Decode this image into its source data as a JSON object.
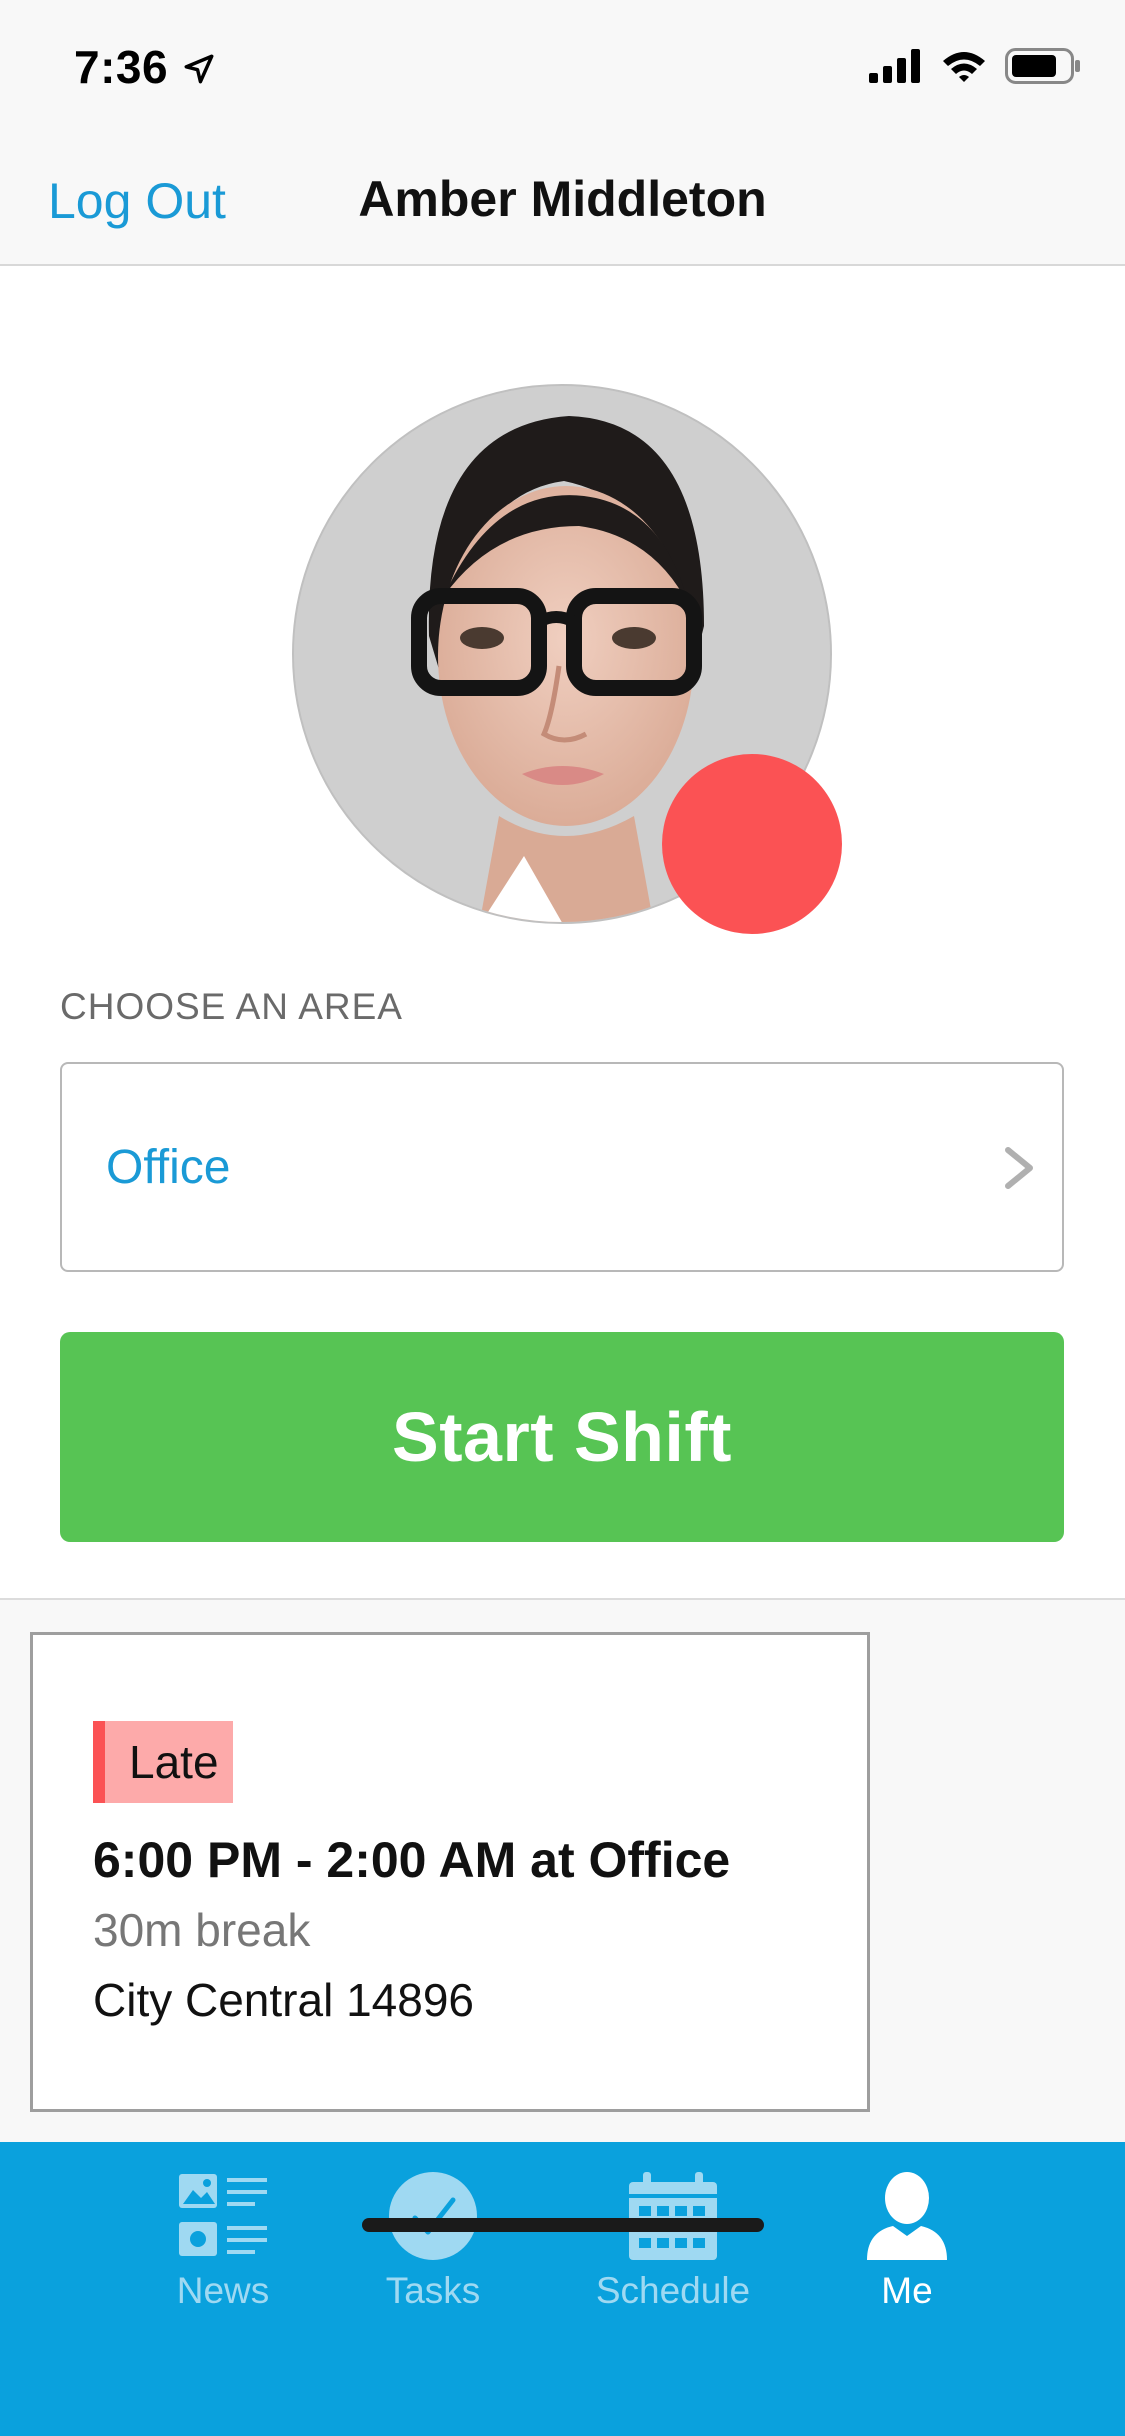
{
  "status_bar": {
    "time": "7:36"
  },
  "nav": {
    "left_button": "Log Out",
    "title": "Amber Middleton"
  },
  "profile": {
    "area_label": "CHOOSE AN AREA",
    "area_value": "Office",
    "start_button": "Start Shift",
    "status_color": "#fb5254"
  },
  "shift": {
    "badge": "Late",
    "time": "6:00 PM - 2:00 AM at Office",
    "break": "30m break",
    "location": "City Central 14896"
  },
  "tabs": [
    {
      "label": "News",
      "icon": "news-icon",
      "active": false
    },
    {
      "label": "Tasks",
      "icon": "checkmark-icon",
      "active": false
    },
    {
      "label": "Schedule",
      "icon": "calendar-icon",
      "active": false
    },
    {
      "label": "Me",
      "icon": "person-icon",
      "active": true
    }
  ],
  "colors": {
    "accent": "#1a9ad6",
    "start_button": "#57c454",
    "tab_bar": "#0aa1dd",
    "late_badge": "#fdaaaa"
  }
}
